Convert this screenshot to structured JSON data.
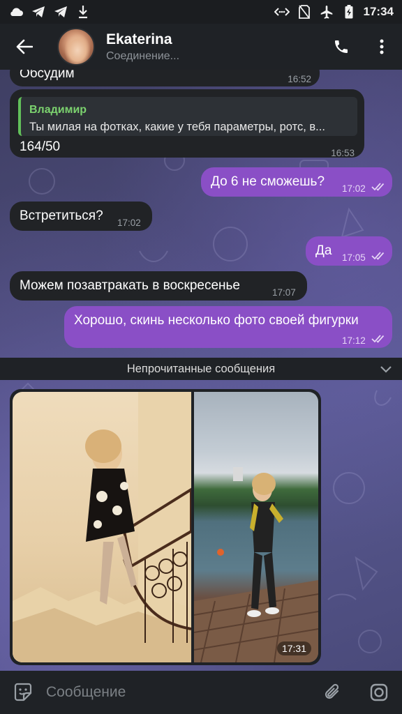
{
  "status_bar": {
    "time": "17:34",
    "left_icons": [
      "cloud-icon",
      "telegram-icon",
      "telegram-icon",
      "download-icon"
    ],
    "right_icons": [
      "data-saver-icon",
      "no-sim-icon",
      "airplane-icon",
      "battery-charging-icon"
    ]
  },
  "header": {
    "contact_name": "Ekaterina",
    "contact_status": "Соединение..."
  },
  "messages": [
    {
      "direction": "in",
      "text": "Обсудим",
      "time": "16:52"
    },
    {
      "direction": "in",
      "reply_author": "Владимир",
      "reply_text": "Ты милая на фотках, какие у тебя параметры, ротс, в...",
      "text": "164/50",
      "time": "16:53"
    },
    {
      "direction": "out",
      "text": "До 6 не сможешь?",
      "time": "17:02",
      "status": "read"
    },
    {
      "direction": "in",
      "text": "Встретиться?",
      "time": "17:02"
    },
    {
      "direction": "out",
      "text": "Да",
      "time": "17:05",
      "status": "read"
    },
    {
      "direction": "in",
      "text": "Можем позавтракать в воскресенье",
      "time": "17:07"
    },
    {
      "direction": "out",
      "text": "Хорошо, скинь несколько фото своей фигурки",
      "time": "17:12",
      "status": "read"
    }
  ],
  "unread_divider": "Непрочитанные сообщения",
  "album": {
    "time": "17:31",
    "photos": [
      "photo-woman-on-staircase",
      "photo-woman-in-wetsuit-on-pier"
    ]
  },
  "input": {
    "placeholder": "Сообщение"
  },
  "colors": {
    "outgoing_bubble": "#8a4fc6",
    "incoming_bubble": "#212326",
    "reply_accent": "#62c05a"
  }
}
